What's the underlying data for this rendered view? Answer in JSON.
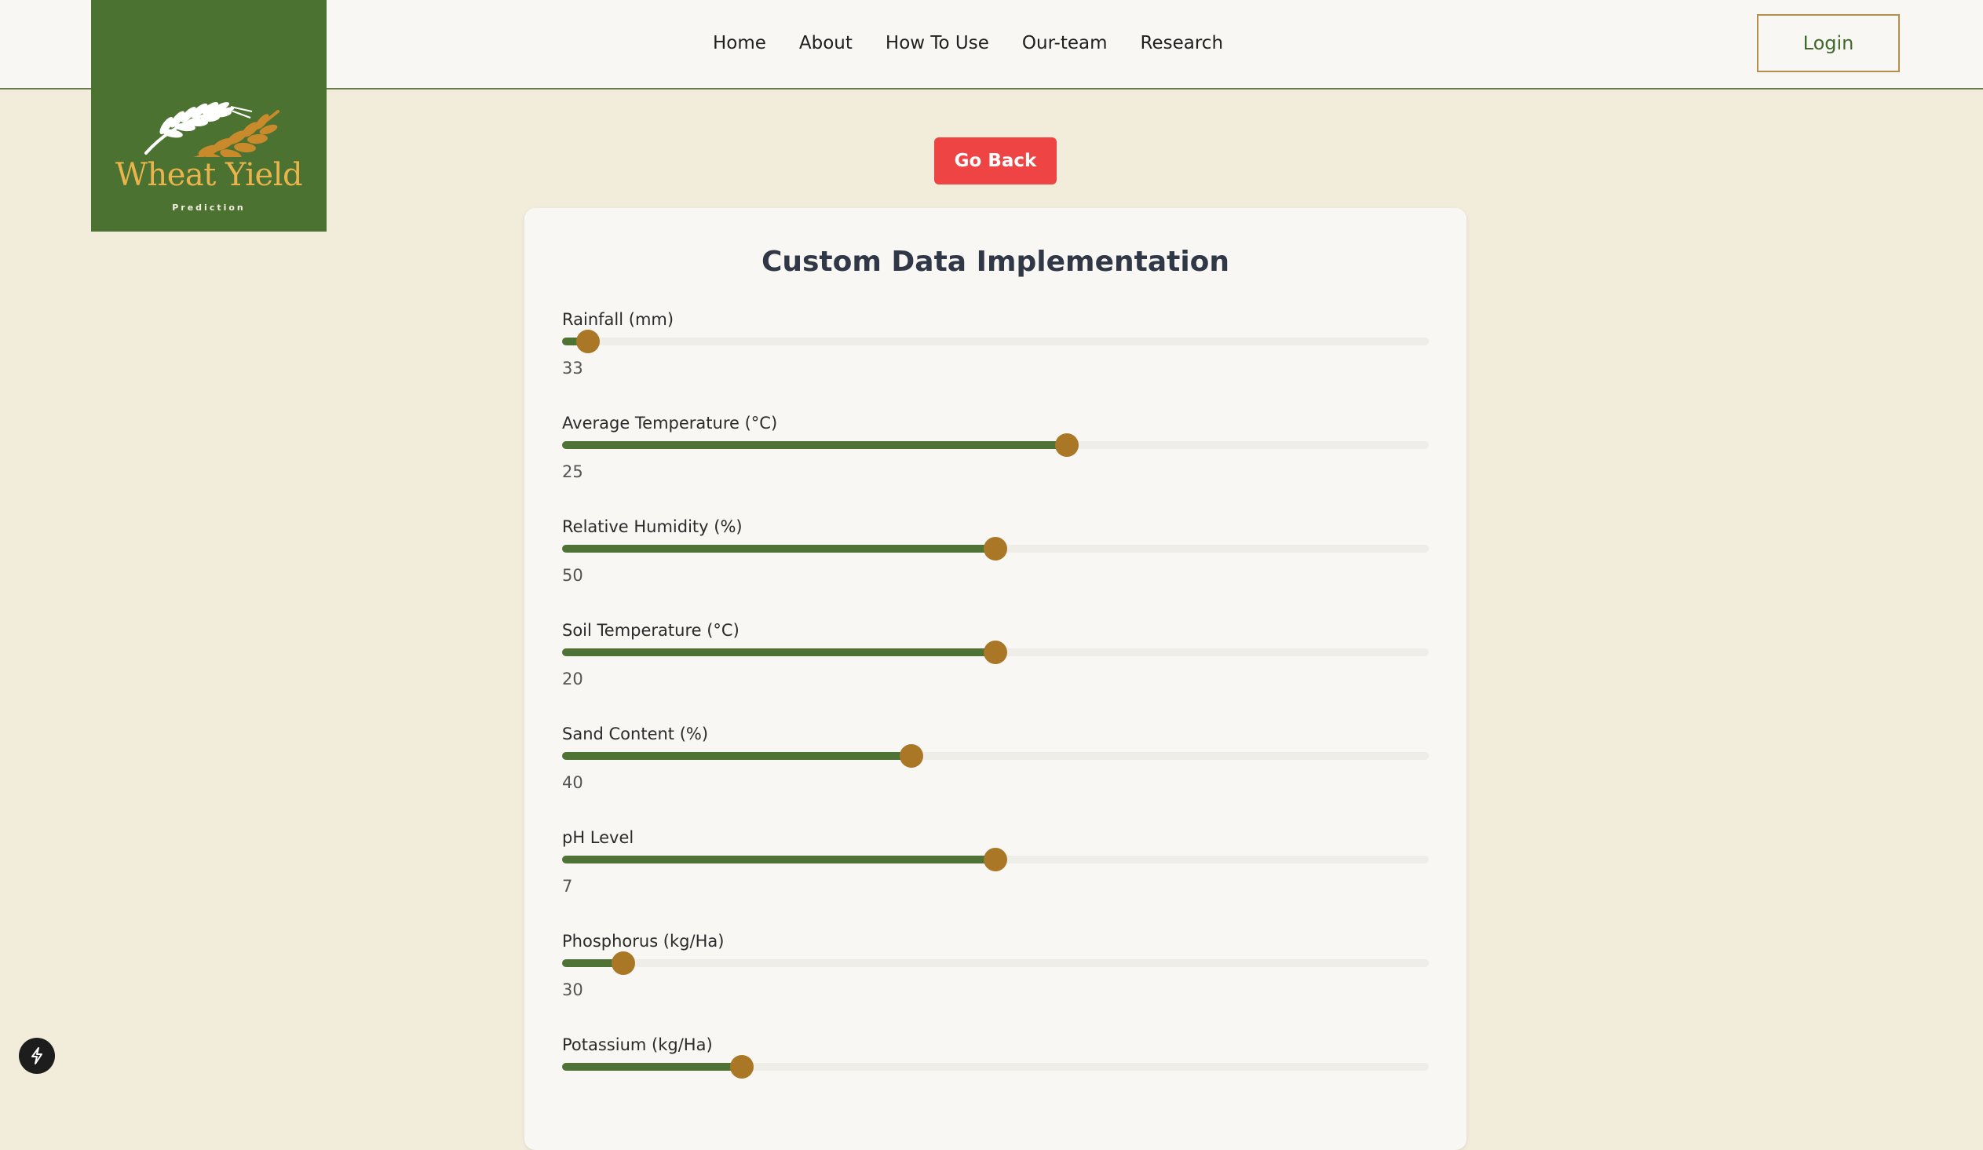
{
  "brand": {
    "title": "Wheat Yield",
    "subtitle": "Prediction",
    "colors": {
      "background": "#4b7230",
      "title": "#e9b44c"
    }
  },
  "nav": {
    "items": [
      {
        "label": "Home"
      },
      {
        "label": "About"
      },
      {
        "label": "How To Use"
      },
      {
        "label": "Our-team"
      },
      {
        "label": "Research"
      }
    ],
    "login_label": "Login"
  },
  "go_back_label": "Go Back",
  "form": {
    "title": "Custom Data Implementation",
    "sliders": [
      {
        "label": "Rainfall (mm)",
        "value": "33",
        "fraction": 0.03
      },
      {
        "label": "Average Temperature (°C)",
        "value": "25",
        "fraction": 0.582
      },
      {
        "label": "Relative Humidity (%)",
        "value": "50",
        "fraction": 0.5
      },
      {
        "label": "Soil Temperature (°C)",
        "value": "20",
        "fraction": 0.5
      },
      {
        "label": "Sand Content (%)",
        "value": "40",
        "fraction": 0.403
      },
      {
        "label": "pH Level",
        "value": "7",
        "fraction": 0.5
      },
      {
        "label": "Phosphorus (kg/Ha)",
        "value": "30",
        "fraction": 0.071
      },
      {
        "label": "Potassium (kg/Ha)",
        "value": "",
        "fraction": 0.207
      }
    ]
  },
  "icons": {
    "logo": "wheat-icon",
    "floating": "bolt-icon"
  },
  "colors": {
    "page_bg": "#f2ecdb",
    "header_bg": "#f8f7f3",
    "accent_green": "#4e7335",
    "thumb": "#a97725",
    "go_back": "#ef4444",
    "login_border": "#b4904a"
  }
}
